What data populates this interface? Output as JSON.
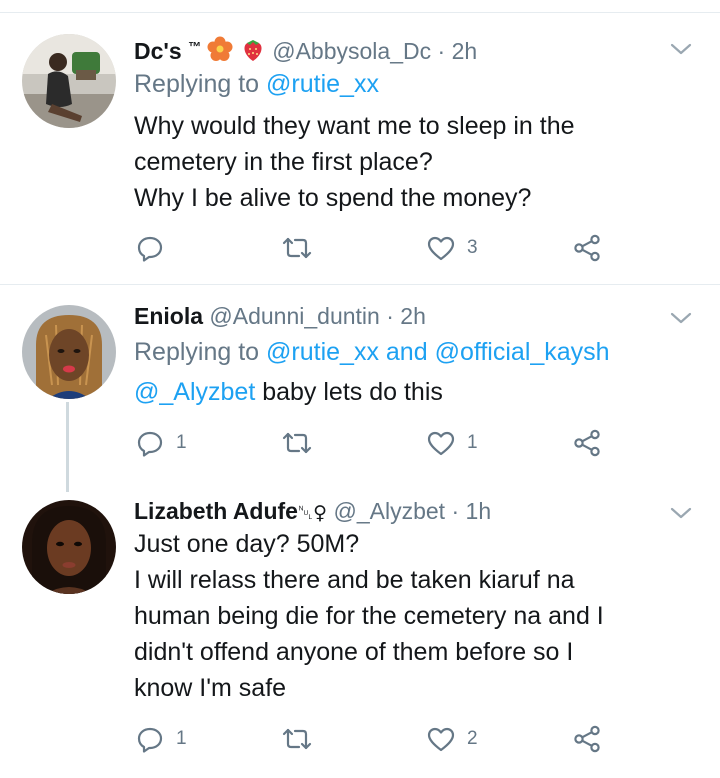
{
  "colors": {
    "accent": "#1da1f2",
    "muted": "#657786",
    "text": "#14171a",
    "divider": "#e6ecf0"
  },
  "tweets": [
    {
      "name": "Dc's",
      "badge": "™",
      "emojis": [
        "hibiscus",
        "strawberry"
      ],
      "handle": "@Abbysola_Dc",
      "dot": "·",
      "time": "2h",
      "reply_prefix": "Replying to",
      "reply_to": "@rutie_xx",
      "text_lines": [
        "Why would they want me to sleep in the",
        "cemetery in the first place?",
        "Why I be alive to spend the money?"
      ],
      "reply_count": "",
      "retweet_count": "",
      "like_count": "3"
    },
    {
      "name": "Eniola",
      "handle": "@Adunni_duntin",
      "dot": "·",
      "time": "2h",
      "reply_prefix": "Replying to",
      "reply_to": "@rutie_xx",
      "reply_and": "and",
      "reply_to_2": "@official_kaysh",
      "text_mention": "@_Alyzbet",
      "text_rest": " baby lets do this",
      "reply_count": "1",
      "retweet_count": "",
      "like_count": "1"
    },
    {
      "name": "Lizabeth Adufe",
      "name_suffix": "␀♀",
      "handle": "@_Alyzbet",
      "dot": "·",
      "time": "1h",
      "text_lines": [
        "Just one day? 50M?",
        "I will relass there and be taken kiaruf na",
        "human being die for the cemetery na and I",
        "didn't offend anyone of them before so I",
        "know I'm safe"
      ],
      "reply_count": "1",
      "retweet_count": "",
      "like_count": "2"
    }
  ]
}
